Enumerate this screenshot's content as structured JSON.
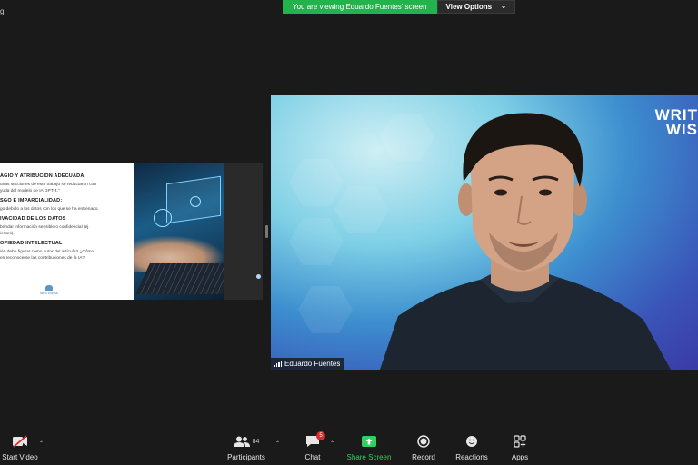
{
  "top_left_label": "g",
  "banner": {
    "viewing_text": "You are viewing Eduardo Fuentes' screen",
    "view_options_label": "View Options"
  },
  "slide": {
    "sections": [
      {
        "heading": "AGIO Y ATRIBUCIÓN ADECUADA:",
        "text": "unas secciones de este trabajo se redactaron con\nyuda del modelo de IA GPT-4.\""
      },
      {
        "heading": "SGO E IMPARCIALIDAD:",
        "text": "go debido a los datos con los que se ha entrenado."
      },
      {
        "heading": "IVACIDAD DE LOS DATOS",
        "text": "brindar información sensible o confidencial (ej.\nientes)."
      },
      {
        "heading": "OPIEDAD INTELECTUAL",
        "text": "ién debe figurar como autor del artículo? ¿Cómo\nen reconocerse las contribuciones de la IA?"
      }
    ],
    "logo_text": "WRITEWISE"
  },
  "video": {
    "participant_name": "Eduardo Fuentes",
    "brand_line1": "WRIT",
    "brand_line2": "WIS"
  },
  "toolbar": {
    "start_video": "Start Video",
    "participants": "Participants",
    "participants_count": "84",
    "chat": "Chat",
    "chat_badge": "5",
    "share_screen": "Share Screen",
    "record": "Record",
    "reactions": "Reactions",
    "apps": "Apps"
  },
  "colors": {
    "share_green": "#2ed160",
    "banner_green": "#22b34c",
    "badge_red": "#e02828"
  }
}
